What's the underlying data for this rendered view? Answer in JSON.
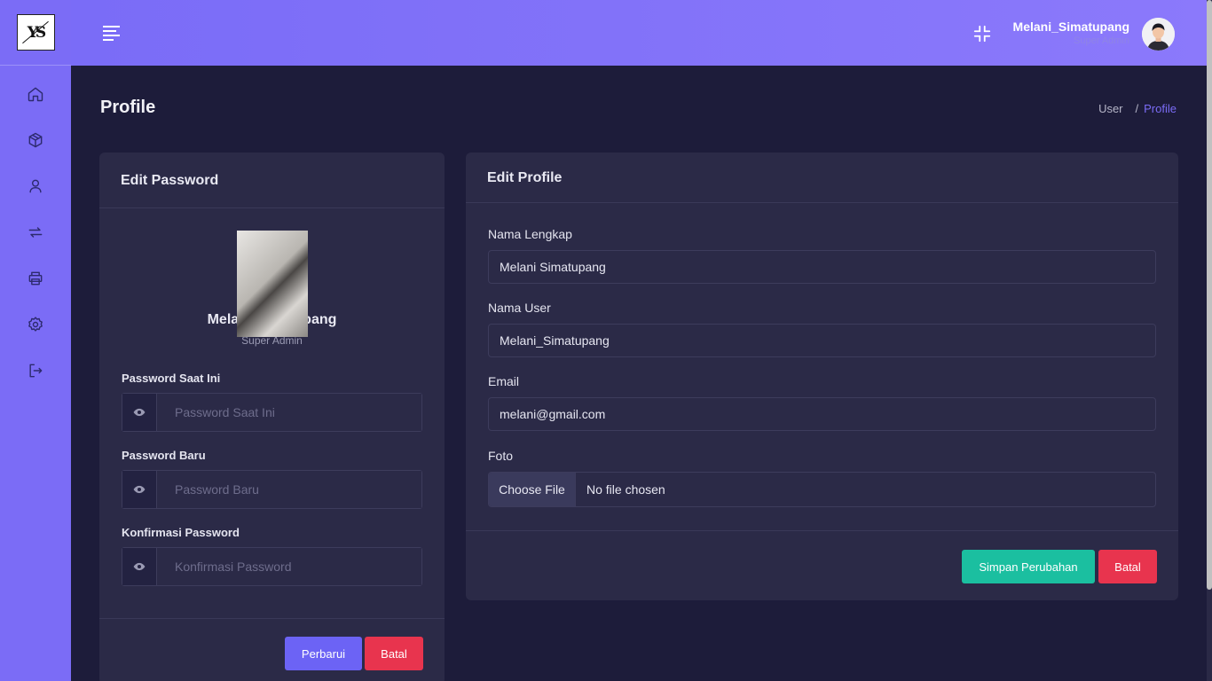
{
  "logo": {
    "text": "YS"
  },
  "sidebar": {
    "items": [
      {
        "name": "home-icon"
      },
      {
        "name": "box-icon"
      },
      {
        "name": "user-icon"
      },
      {
        "name": "repeat-icon"
      },
      {
        "name": "printer-icon"
      },
      {
        "name": "gear-icon"
      },
      {
        "name": "logout-icon"
      }
    ]
  },
  "header": {
    "user_name": "Melani_Simatupang",
    "user_role": "Super Admin"
  },
  "page": {
    "title": "Profile",
    "breadcrumb": {
      "parent": "User",
      "separator": "/",
      "current": "Profile"
    }
  },
  "edit_password": {
    "title": "Edit Password",
    "profile_name": "Melani Simatupang",
    "profile_role": "Super Admin",
    "fields": [
      {
        "label": "Password Saat Ini",
        "placeholder": "Password Saat Ini"
      },
      {
        "label": "Password Baru",
        "placeholder": "Password Baru"
      },
      {
        "label": "Konfirmasi Password",
        "placeholder": "Konfirmasi Password"
      }
    ],
    "update_label": "Perbarui",
    "cancel_label": "Batal"
  },
  "edit_profile": {
    "title": "Edit Profile",
    "full_name": {
      "label": "Nama Lengkap",
      "value": "Melani Simatupang"
    },
    "username": {
      "label": "Nama User",
      "value": "Melani_Simatupang"
    },
    "email": {
      "label": "Email",
      "value": "melani@gmail.com"
    },
    "photo": {
      "label": "Foto",
      "button": "Choose File",
      "status": "No file chosen"
    },
    "save_label": "Simpan Perubahan",
    "cancel_label": "Batal"
  },
  "colors": {
    "sidebar": "#7b6cf6",
    "background": "#1d1c3a",
    "card": "#2b2a47",
    "primary": "#6c63f5",
    "danger": "#e8344e",
    "success": "#1bbfa0"
  }
}
